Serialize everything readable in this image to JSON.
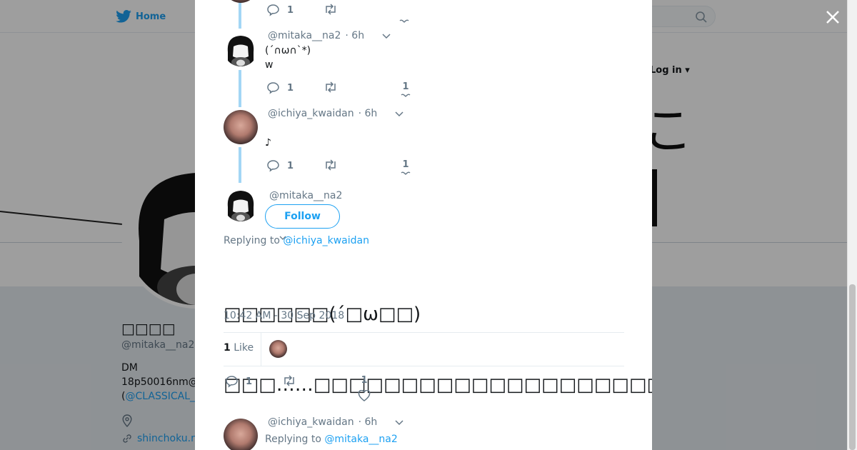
{
  "topnav": {
    "home_label": "Home",
    "login_label": "Log in"
  },
  "profile": {
    "name": "□□□□",
    "handle": "@mitaka__na2",
    "bio_line1": "DM",
    "bio_line2": "18p50016nm@",
    "bio_line3_prefix": "(",
    "bio_line3_link": "@CLASSICAL_",
    "website": "shinchoku.n"
  },
  "modal": {
    "close_label": "×",
    "tweets": [
      {
        "reply_count": "1"
      },
      {
        "handle": "@mitaka__na2",
        "time": "· 6h",
        "line1": "(´∩ω∩`*)",
        "line2": "w",
        "reply_count": "1",
        "like_count": "1"
      },
      {
        "handle": "@ichiya_kwaidan",
        "time": "· 6h",
        "line1": "♪",
        "reply_count": "1",
        "like_count": "1"
      }
    ],
    "focused": {
      "handle": "@mitaka__na2",
      "follow_label": "Follow",
      "replying_prefix": "Replying to",
      "replying_to": "@ichiya_kwaidan",
      "text_line1": "□□□□□□(´□ω□□)",
      "text_line2": "□□□……□□□□□□□□□□□□□□□□□□□□",
      "timestamp": "10:42 AM - 30 Sep 2018",
      "like_count": "1",
      "like_label": "Like",
      "reply_count": "1",
      "action_like_count": "1"
    },
    "next_reply": {
      "handle": "@ichiya_kwaidan",
      "time": "· 6h",
      "replying_prefix": "Replying to",
      "replying_to": "@mitaka__na2"
    }
  },
  "colors": {
    "accent": "#1da1f2",
    "thread_line": "#a3d6f5",
    "muted": "#657786"
  }
}
